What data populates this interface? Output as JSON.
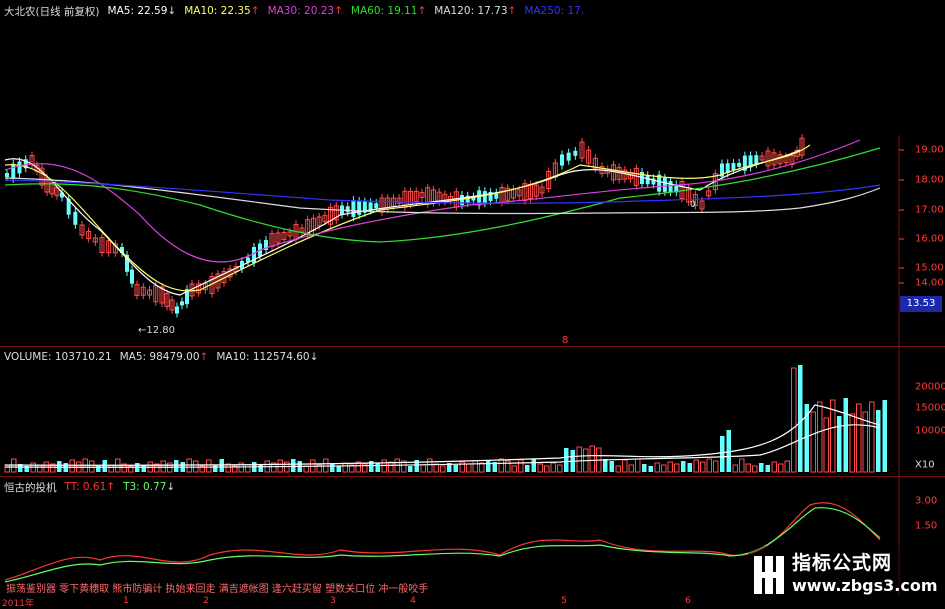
{
  "main": {
    "title": "大北农(日线 前复权)",
    "ma": [
      {
        "label": "MA5: 22.59",
        "dir": "down",
        "color": "#ffffff"
      },
      {
        "label": "MA10: 22.35",
        "dir": "up",
        "color": "#ffff66"
      },
      {
        "label": "MA30: 20.23",
        "dir": "up",
        "color": "#e040e0"
      },
      {
        "label": "MA60: 19.11",
        "dir": "up",
        "color": "#33dd33"
      },
      {
        "label": "MA120: 17.73",
        "dir": "up",
        "color": "#dddddd"
      },
      {
        "label": "MA250: 17.",
        "dir": "",
        "color": "#3333ff"
      }
    ],
    "y_ticks": [
      "19.00",
      "18.00",
      "17.00",
      "16.00",
      "15.00",
      "14.00"
    ],
    "current_price": "13.53",
    "low_label": "12.80",
    "mid_marker": "8",
    "lows_marker": "0"
  },
  "volume": {
    "title": "VOLUME: 103710.21",
    "ma": [
      {
        "label": "MA5: 98479.00",
        "dir": "up",
        "color": "#ffffff"
      },
      {
        "label": "MA10: 112574.60",
        "dir": "down",
        "color": "#ffffff"
      }
    ],
    "y_ticks": [
      "20000",
      "15000",
      "10000"
    ],
    "unit": "X10"
  },
  "indicator": {
    "title": "恒古的投机",
    "lines": [
      {
        "label": "TT: 0.61",
        "dir": "up",
        "color": "#ff3333"
      },
      {
        "label": "T3: 0.77",
        "dir": "down",
        "color": "#66ff66"
      }
    ],
    "y_ticks": [
      "3.00",
      "1.50"
    ],
    "note": "振荡鉴别器 零下黄穗取 熊市防骗计 执始来回走 满吉遮帐图 逢六赶买留 塑数关口位 冲一般咬手"
  },
  "x_axis": [
    "2011年",
    "1",
    "2",
    "3",
    "4",
    "5",
    "6"
  ],
  "brand": {
    "name": "指标公式网",
    "url": "www.zbgs3.com"
  },
  "colors": {
    "up": "#ff4a4a",
    "down": "#6ff",
    "bg": "#000000",
    "grid": "#7a1010"
  }
}
